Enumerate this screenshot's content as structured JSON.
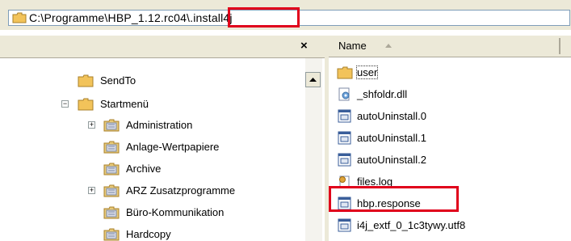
{
  "address_bar": {
    "path": "C:\\Programme\\HBP_1.12.rc04\\.install4j"
  },
  "tree_pane": {
    "close_label": "×",
    "items": [
      {
        "label": "SendTo",
        "expander": ""
      },
      {
        "label": "Startmenü",
        "expander": "−"
      },
      {
        "label": "Administration",
        "expander": "+"
      },
      {
        "label": "Anlage-Wertpapiere",
        "expander": ""
      },
      {
        "label": "Archive",
        "expander": ""
      },
      {
        "label": "ARZ Zusatzprogramme",
        "expander": "+"
      },
      {
        "label": "Büro-Kommunikation",
        "expander": ""
      },
      {
        "label": "Hardcopy",
        "expander": ""
      }
    ]
  },
  "file_pane": {
    "column_name": "Name",
    "files": [
      {
        "label": "user",
        "icon": "folder-icon"
      },
      {
        "label": "_shfoldr.dll",
        "icon": "dll-icon"
      },
      {
        "label": "autoUninstall.0",
        "icon": "script-file-icon"
      },
      {
        "label": "autoUninstall.1",
        "icon": "script-file-icon"
      },
      {
        "label": "autoUninstall.2",
        "icon": "script-file-icon"
      },
      {
        "label": "files.log",
        "icon": "log-file-icon"
      },
      {
        "label": "hbp.response",
        "icon": "script-file-icon"
      },
      {
        "label": "i4j_extf_0_1c3tywy.utf8",
        "icon": "script-file-icon"
      }
    ]
  },
  "colors": {
    "highlight": "#e0001b",
    "folder": "#f2c35a",
    "chrome": "#ece9d8"
  }
}
